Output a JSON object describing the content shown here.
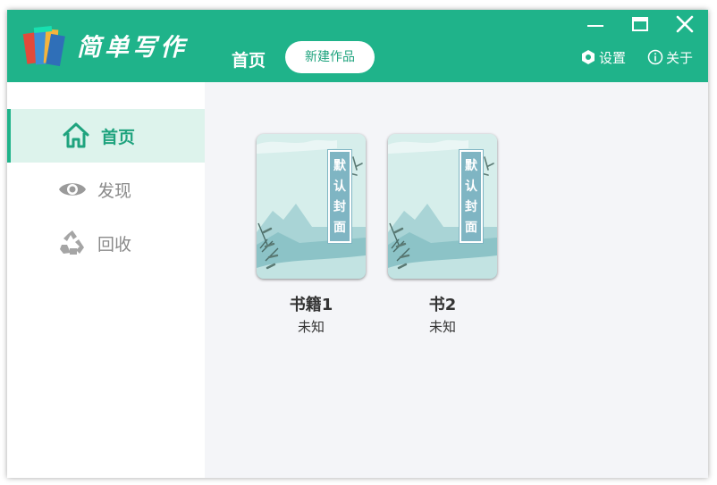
{
  "app": {
    "title": "简单写作"
  },
  "header": {
    "home_label": "首页",
    "new_work_label": "新建作品",
    "settings_label": "设置",
    "about_label": "关于"
  },
  "sidebar": {
    "items": [
      {
        "label": "首页",
        "icon": "home-icon",
        "active": true
      },
      {
        "label": "发现",
        "icon": "eye-icon",
        "active": false
      },
      {
        "label": "回收",
        "icon": "recycle-icon",
        "active": false
      }
    ]
  },
  "books": [
    {
      "title": "书籍1",
      "author": "未知",
      "cover_text": [
        "默",
        "认",
        "封",
        "面"
      ]
    },
    {
      "title": "书2",
      "author": "未知",
      "cover_text": [
        "默",
        "认",
        "封",
        "面"
      ]
    }
  ],
  "colors": {
    "accent": "#1fb38a",
    "accent_dark": "#1fa37e",
    "sidebar_active_bg": "#ddf3ec",
    "main_bg": "#f4f5f8"
  }
}
